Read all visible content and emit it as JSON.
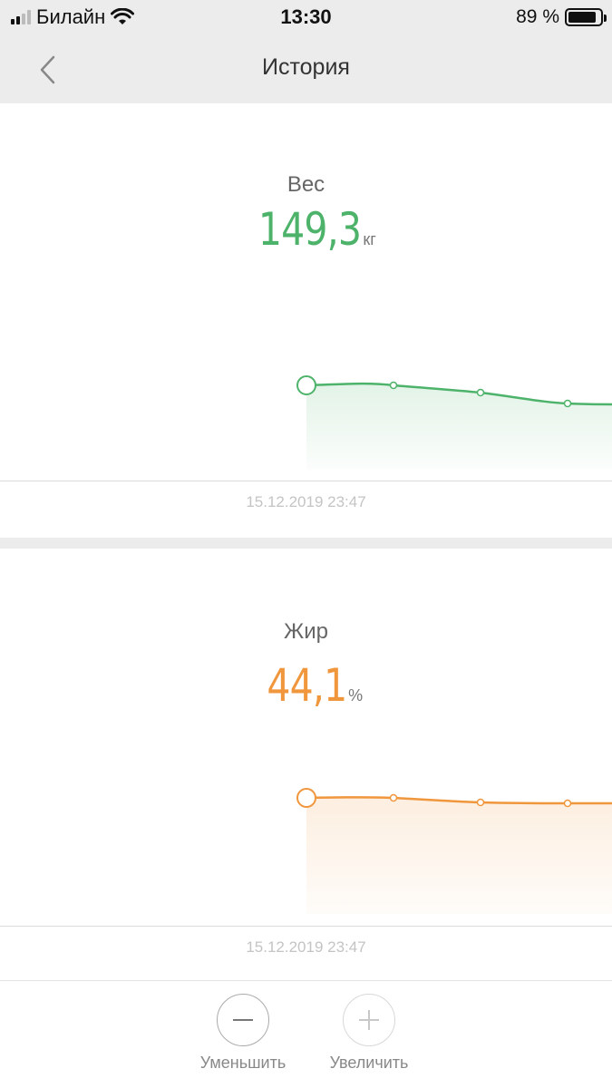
{
  "status_bar": {
    "carrier": "Билайн",
    "time": "13:30",
    "battery": "89 %",
    "battery_level": 0.89
  },
  "nav": {
    "title": "История",
    "back_icon": "chevron-left-icon"
  },
  "weight": {
    "label": "Вес",
    "value": "149,3",
    "unit": "кг",
    "date": "15.12.2019 23:47",
    "color": "#4db36a"
  },
  "fat": {
    "label": "Жир",
    "value": "44,1",
    "unit": "%",
    "date": "15.12.2019 23:47",
    "color": "#f0963c"
  },
  "toolbar": {
    "decrease_label": "Уменьшить",
    "increase_label": "Увеличить",
    "decrease_icon": "minus-icon",
    "increase_icon": "plus-icon"
  }
}
